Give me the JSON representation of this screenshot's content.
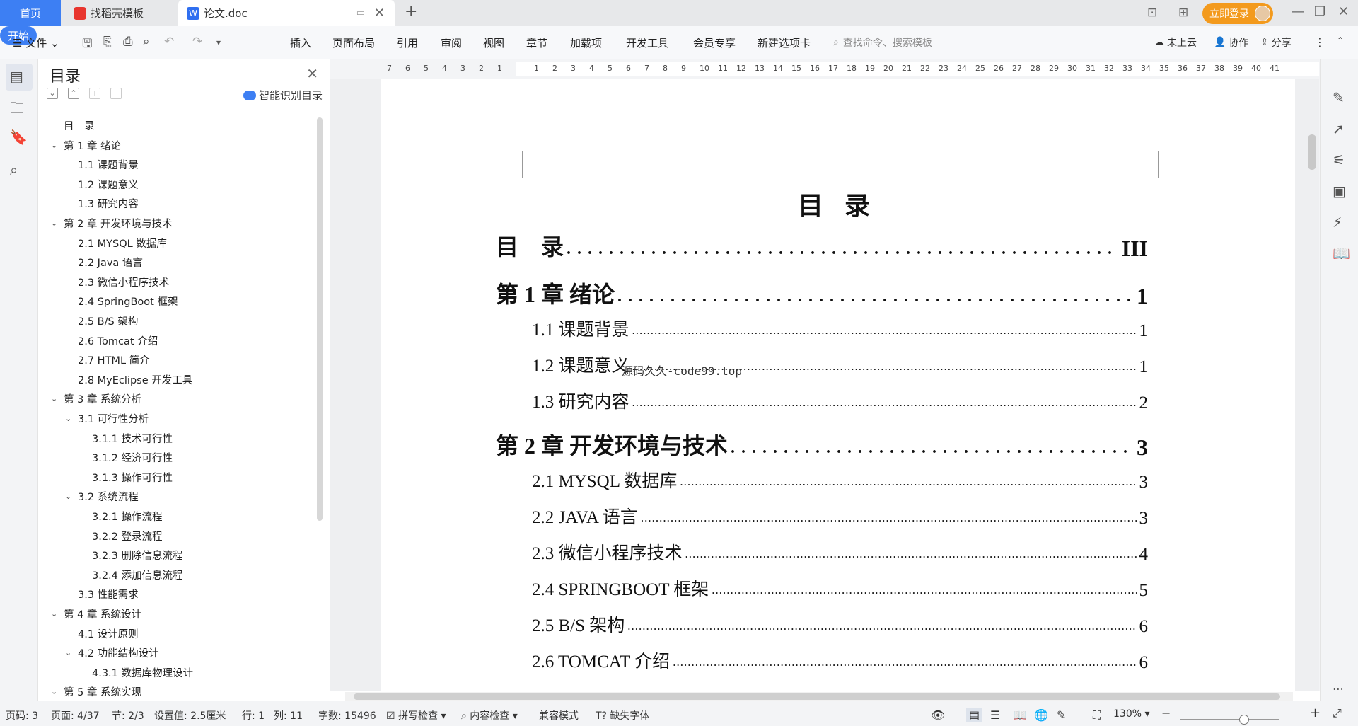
{
  "tabs": {
    "home": "首页",
    "template": "找稻壳模板",
    "doc": "论文.doc"
  },
  "header": {
    "login": "立即登录"
  },
  "menu": {
    "file": "文件",
    "items": [
      "开始",
      "插入",
      "页面布局",
      "引用",
      "审阅",
      "视图",
      "章节",
      "加载项",
      "开发工具",
      "会员专享",
      "新建选项卡"
    ],
    "search_placeholder": "查找命令、搜索模板",
    "cloud": "未上云",
    "collab": "协作",
    "share": "分享"
  },
  "nav": {
    "title": "目录",
    "smart": "智能识别目录",
    "items": [
      {
        "label": "目　录",
        "level": 0,
        "exp": ""
      },
      {
        "label": "第 1 章  绪论",
        "level": 0,
        "exp": "v"
      },
      {
        "label": "1.1  课题背景",
        "level": 1,
        "exp": ""
      },
      {
        "label": "1.2  课题意义",
        "level": 1,
        "exp": ""
      },
      {
        "label": "1.3  研究内容",
        "level": 1,
        "exp": ""
      },
      {
        "label": "第 2 章  开发环境与技术",
        "level": 0,
        "exp": "v"
      },
      {
        "label": "2.1 MYSQL 数据库",
        "level": 1,
        "exp": ""
      },
      {
        "label": "2.2 Java 语言",
        "level": 1,
        "exp": ""
      },
      {
        "label": "2.3  微信小程序技术",
        "level": 1,
        "exp": ""
      },
      {
        "label": "2.4 SpringBoot 框架",
        "level": 1,
        "exp": ""
      },
      {
        "label": "2.5 B/S 架构",
        "level": 1,
        "exp": ""
      },
      {
        "label": "2.6 Tomcat  介绍",
        "level": 1,
        "exp": ""
      },
      {
        "label": "2.7 HTML 简介",
        "level": 1,
        "exp": ""
      },
      {
        "label": "2.8 MyEclipse 开发工具",
        "level": 1,
        "exp": ""
      },
      {
        "label": "第 3 章  系统分析",
        "level": 0,
        "exp": "v"
      },
      {
        "label": "3.1  可行性分析",
        "level": 1,
        "exp": "v"
      },
      {
        "label": "3.1.1  技术可行性",
        "level": 2,
        "exp": ""
      },
      {
        "label": "3.1.2  经济可行性",
        "level": 2,
        "exp": ""
      },
      {
        "label": "3.1.3  操作可行性",
        "level": 2,
        "exp": ""
      },
      {
        "label": "3.2  系统流程",
        "level": 1,
        "exp": "v"
      },
      {
        "label": "3.2.1  操作流程",
        "level": 2,
        "exp": ""
      },
      {
        "label": "3.2.2  登录流程",
        "level": 2,
        "exp": ""
      },
      {
        "label": "3.2.3  删除信息流程",
        "level": 2,
        "exp": ""
      },
      {
        "label": "3.2.4  添加信息流程",
        "level": 2,
        "exp": ""
      },
      {
        "label": "3.3  性能需求",
        "level": 1,
        "exp": ""
      },
      {
        "label": "第 4 章  系统设计",
        "level": 0,
        "exp": "v"
      },
      {
        "label": "4.1  设计原则",
        "level": 1,
        "exp": ""
      },
      {
        "label": "4.2  功能结构设计",
        "level": 1,
        "exp": "v"
      },
      {
        "label": "4.3.1  数据库物理设计",
        "level": 2,
        "exp": ""
      },
      {
        "label": "第 5 章  系统实现",
        "level": 0,
        "exp": "v"
      }
    ]
  },
  "ruler": [
    "7",
    "6",
    "5",
    "4",
    "3",
    "2",
    "1",
    "",
    "1",
    "2",
    "3",
    "4",
    "5",
    "6",
    "7",
    "8",
    "9",
    "10",
    "11",
    "12",
    "13",
    "14",
    "15",
    "16",
    "17",
    "18",
    "19",
    "20",
    "21",
    "22",
    "23",
    "24",
    "25",
    "26",
    "27",
    "28",
    "29",
    "30",
    "31",
    "32",
    "33",
    "34",
    "35",
    "36",
    "37",
    "38",
    "39",
    "40",
    "41"
  ],
  "document": {
    "heading": "目录",
    "watermark": "源码久久-code99.top",
    "entries": [
      {
        "label": "目　录",
        "page": "III",
        "level": 1
      },
      {
        "label": "第 1 章  绪论",
        "page": "1",
        "level": 1
      },
      {
        "label": "1.1  课题背景",
        "page": "1",
        "level": 2
      },
      {
        "label": "1.2  课题意义",
        "page": "1",
        "level": 2
      },
      {
        "label": "1.3  研究内容",
        "page": "2",
        "level": 2
      },
      {
        "label": "第 2 章  开发环境与技术",
        "page": "3",
        "level": 1
      },
      {
        "label": "2.1 MYSQL 数据库",
        "page": "3",
        "level": 2
      },
      {
        "label": "2.2 JAVA 语言",
        "page": "3",
        "level": 2
      },
      {
        "label": "2.3  微信小程序技术",
        "page": "4",
        "level": 2
      },
      {
        "label": "2.4 SPRINGBOOT 框架",
        "page": "5",
        "level": 2
      },
      {
        "label": "2.5 B/S 架构",
        "page": "6",
        "level": 2
      },
      {
        "label": "2.6 TOMCAT 介绍",
        "page": "6",
        "level": 2
      }
    ]
  },
  "status": {
    "page": "页码: 3",
    "pages": "页面: 4/37",
    "section": "节: 2/3",
    "setting": "设置值: 2.5厘米",
    "row": "行: 1",
    "col": "列: 11",
    "words": "字数: 15496",
    "spell": "拼写检查",
    "content": "内容检查",
    "compat": "兼容模式",
    "font": "缺失字体",
    "zoom": "130%"
  }
}
